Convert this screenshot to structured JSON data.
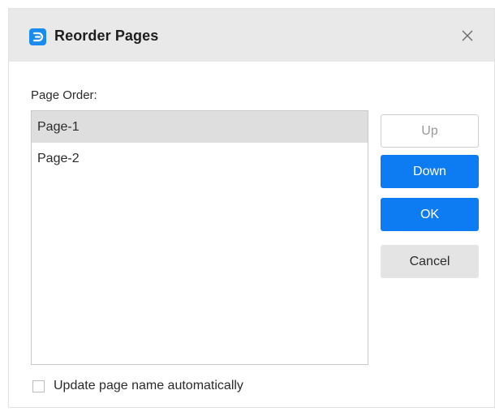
{
  "dialog": {
    "title": "Reorder Pages",
    "app_icon": "edraw-logo-icon",
    "close_icon": "close-icon"
  },
  "page_order": {
    "label": "Page Order:",
    "items": [
      {
        "label": "Page-1",
        "selected": true
      },
      {
        "label": "Page-2",
        "selected": false
      }
    ]
  },
  "buttons": {
    "up": "Up",
    "down": "Down",
    "ok": "OK",
    "cancel": "Cancel"
  },
  "options": {
    "update_name_label": "Update page name automatically",
    "update_name_checked": false
  },
  "colors": {
    "accent": "#0d7bf2",
    "titlebar": "#e9e9e9",
    "selection": "#dedede"
  }
}
